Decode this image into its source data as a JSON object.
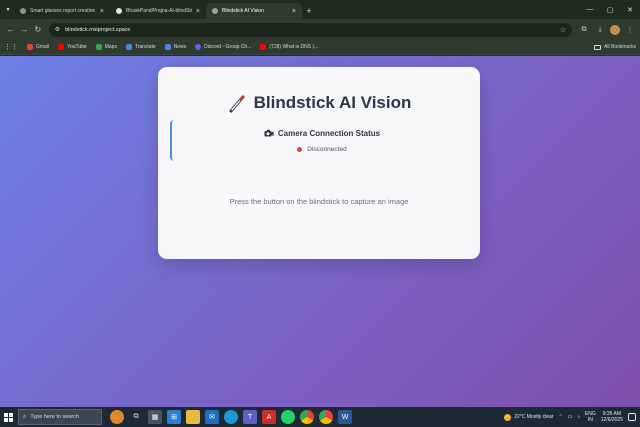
{
  "browser": {
    "tabs": [
      {
        "title": "Smart glasses report creation",
        "favicon": "chatgpt-icon",
        "active": false
      },
      {
        "title": "BhaskPand/Prajna-AI-blindStick",
        "favicon": "github-icon",
        "active": false
      },
      {
        "title": "Blindstick AI Vision",
        "favicon": "globe-icon",
        "active": true
      }
    ],
    "url": "blindstick.msiproject.space",
    "bookmarks": [
      {
        "label": "Gmail",
        "color": "#ea4335"
      },
      {
        "label": "YouTube",
        "color": "#ff0000"
      },
      {
        "label": "Maps",
        "color": "#34a853"
      },
      {
        "label": "Translate",
        "color": "#4285f4"
      },
      {
        "label": "News",
        "color": "#4285f4"
      },
      {
        "label": "Discord - Group Ch...",
        "color": "#5865f2"
      },
      {
        "label": "(728) What is DNS (...",
        "color": "#ff0000"
      }
    ],
    "all_bookmarks": "All Bookmarks"
  },
  "page": {
    "title": "Blindstick AI Vision",
    "status_heading": "Camera Connection Status",
    "status_text": "Disconnected",
    "status_color": "#e53e3e",
    "instruction": "Press the button on the blindstick to capture an image"
  },
  "taskbar": {
    "search_placeholder": "Type here to search",
    "weather": "22°C  Mostly clear",
    "lang_line1": "ENG",
    "lang_line2": "IN",
    "time": "9:35 AM",
    "date": "12/6/2025"
  }
}
